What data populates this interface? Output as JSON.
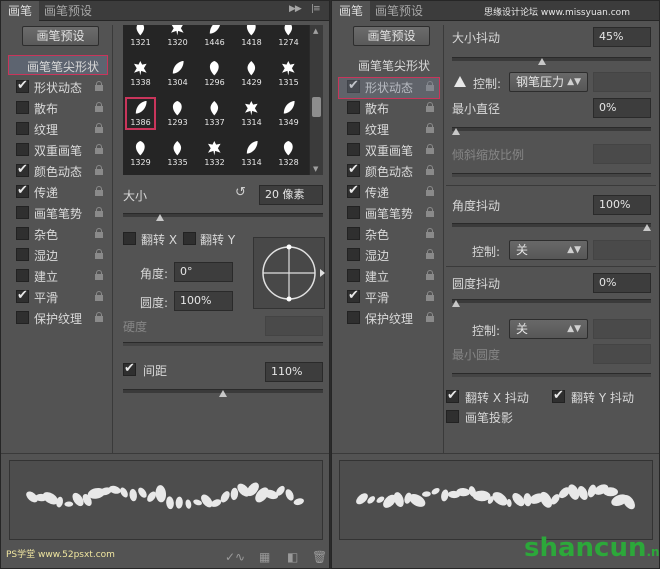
{
  "watermark": {
    "top_right": "思缘设计论坛  www.missyuan.com",
    "bottom_left": "PS学堂  www.52psxt.com",
    "bottom_right": "shancun",
    "bottom_right_suffix": ".net"
  },
  "left_panel": {
    "tabs": [
      "画笔",
      "画笔预设"
    ],
    "preset_button": "画笔预设",
    "tip_shape_label": "画笔笔尖形状",
    "options": [
      {
        "label": "形状动态",
        "checked": true
      },
      {
        "label": "散布",
        "checked": false
      },
      {
        "label": "纹理",
        "checked": false
      },
      {
        "label": "双重画笔",
        "checked": false
      },
      {
        "label": "颜色动态",
        "checked": true
      },
      {
        "label": "传递",
        "checked": true
      },
      {
        "label": "画笔笔势",
        "checked": false
      },
      {
        "label": "杂色",
        "checked": false
      },
      {
        "label": "湿边",
        "checked": false
      },
      {
        "label": "建立",
        "checked": false
      },
      {
        "label": "平滑",
        "checked": true
      },
      {
        "label": "保护纹理",
        "checked": false
      }
    ],
    "brush_numbers": [
      [
        "1321",
        "1320",
        "1446",
        "1418",
        "1274"
      ],
      [
        "1338",
        "1304",
        "1296",
        "1429",
        "1315"
      ],
      [
        "1386",
        "1293",
        "1337",
        "1314",
        "1349"
      ],
      [
        "1329",
        "1335",
        "1332",
        "1314",
        "1328"
      ]
    ],
    "selected_brush": "1386",
    "size_label": "大小",
    "size_value": "20 像素",
    "flip_x": "翻转 X",
    "flip_y": "翻转 Y",
    "angle_label": "角度:",
    "angle_value": "0°",
    "roundness_label": "圆度:",
    "roundness_value": "100%",
    "hardness_label": "硬度",
    "spacing_label": "间距",
    "spacing_checked": true,
    "spacing_value": "110%",
    "size_level": 0.17,
    "spacing_level": 0.5
  },
  "right_panel": {
    "tabs": [
      "画笔",
      "画笔预设"
    ],
    "preset_button": "画笔预设",
    "tip_shape_label": "画笔笔尖形状",
    "options": [
      {
        "label": "形状动态",
        "checked": true
      },
      {
        "label": "散布",
        "checked": false
      },
      {
        "label": "纹理",
        "checked": false
      },
      {
        "label": "双重画笔",
        "checked": false
      },
      {
        "label": "颜色动态",
        "checked": true
      },
      {
        "label": "传递",
        "checked": true
      },
      {
        "label": "画笔笔势",
        "checked": false
      },
      {
        "label": "杂色",
        "checked": false
      },
      {
        "label": "湿边",
        "checked": false
      },
      {
        "label": "建立",
        "checked": false
      },
      {
        "label": "平滑",
        "checked": true
      },
      {
        "label": "保护纹理",
        "checked": false
      }
    ],
    "size_jitter_label": "大小抖动",
    "size_jitter_value": "45%",
    "control_label": "控制:",
    "size_control": "钢笔压力",
    "min_diameter_label": "最小直径",
    "min_diameter_value": "0%",
    "tilt_scale_label": "倾斜缩放比例",
    "angle_jitter_label": "角度抖动",
    "angle_jitter_value": "100%",
    "angle_control": "关",
    "roundness_jitter_label": "圆度抖动",
    "roundness_jitter_value": "0%",
    "roundness_control": "关",
    "min_roundness_label": "最小圆度",
    "flip_x_jitter": "翻转 X 抖动",
    "flip_y_jitter": "翻转 Y 抖动",
    "brush_projection": "画笔投影",
    "size_jitter_level": 0.45,
    "min_diameter_level": 0,
    "angle_jitter_level": 1,
    "roundness_jitter_level": 0
  }
}
